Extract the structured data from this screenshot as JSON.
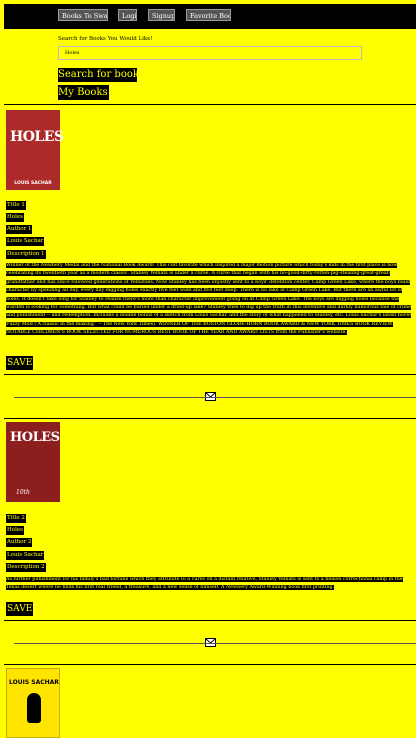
{
  "nav": {
    "items": [
      "Books To Swap",
      "Login",
      "Signup",
      "Favorite Books"
    ]
  },
  "search": {
    "label": "Search for Books You Would Like!",
    "value": "Holes",
    "heading": "Search for book"
  },
  "my_books": {
    "heading": "My Books",
    "save_label": "SAVE",
    "icon": "envelope-icon",
    "entries": [
      {
        "cover_text": "HOLES",
        "cover_author": "LOUIS SACHAR",
        "title": "Title 1",
        "name": "Holes",
        "author_label": "Author 1",
        "author": "Louis Sachar",
        "description_label": "Description 1",
        "description": "Winner of the Newbery Medal and the National Book Award! This cult favorite which inspired a major motion picture which today's kids in the first place is now celebrating its twentieth year as a modern classic. Stanley Yelnats is under a curse. A curse that began with his no-good-dirty-rotten-pig-stealing-great-great-grandfather and has since followed generations of Yelnatses. Now Stanley has been unjustly sent to a boys' detention center, Camp Green Lake, where the boys build character by spending all day, every day digging holes exactly five feet wide and five feet deep. There is no lake at Camp Green Lake. But there are an awful lot of holes. It doesn't take long for Stanley to realize there's more than character improvement going on at Camp Green Lake. The boys are digging holes because the warden is looking for something. But what could be buried under a dried-up lake? Stanley tries to dig up the truth in this inventive and darkly humorous tale of crime and punishment -- and redemption. Includes a double bonus of a sketch from Louis Sachar, and the story of what happened to Stanley, etc. Louis Sachar's latest novel Fuzzy Mud ('A classic in the making.' -- The New York Times). WINNER OF THE BOSTON GLOBE-HORN BOOK AWARD & NEW YORK TIMES BOOK REVIEW NOTABLE CHILDREN'S BOOK SELECTED FOR NUMEROUS BEST BOOK OF THE YEAR AND AWARD LISTS from the Publisher's website."
      },
      {
        "cover_text": "HOLES",
        "cover_author": "10th",
        "title": "Title 2",
        "name": "Holes",
        "author_label": "Author 2",
        "author": "Louis Sachar",
        "description_label": "Description 2",
        "description": "As further punishment for his family's bad fortune which they attribute to a curse on a distant relative, Stanley Yelnats is sent to a hellish correctional camp in the Texas desert where he finds his first real friend, a treasure, and a new sense of himself. A Newbery Award-Winning book first printing."
      },
      {
        "cover_author": "LOUIS SACHAR"
      }
    ]
  },
  "colors": {
    "background": "#ffff00",
    "text_bg": "#000000",
    "text": "#ffff00"
  }
}
